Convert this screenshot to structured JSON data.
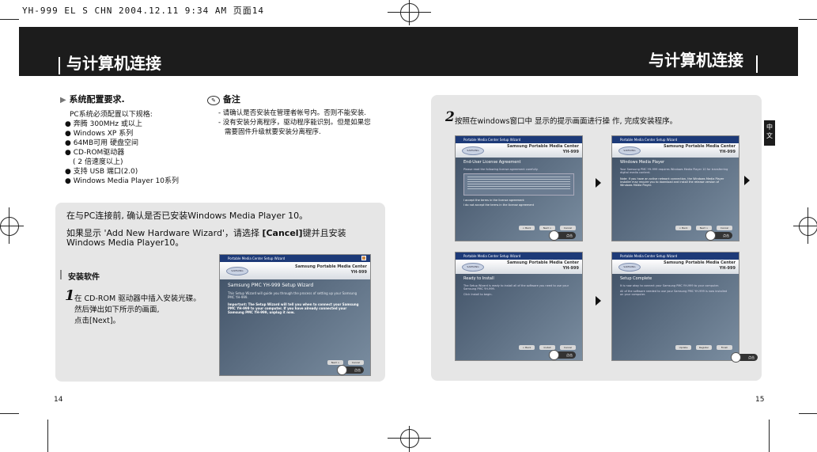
{
  "print_header": "YH-999 EL S CHN 2004.12.11 9:34 AM 页面14",
  "left_title": "与计算机连接",
  "right_title": "与计算机连接",
  "side_tab": "中文",
  "requirements": {
    "heading": "系统配置要求.",
    "intro": "PC系统必须配置以下规格:",
    "items": [
      "奔腾 300MHz 或以上",
      "Windows XP 系列",
      "64MB可用 硬盘空间",
      "CD-ROM驱动器",
      "( 2 倍速度以上)",
      "支持 USB 端口(2.0)",
      "Windows Media Player 10系列"
    ]
  },
  "note": {
    "heading": "备注",
    "lines": [
      "- 请确认是否安装在管理者帐号内。否则不能安装.",
      "- 没有安装分离程序，驱动程序能识别。但是如果您",
      "需要固件升级就要安装分离程序."
    ]
  },
  "left_panel": {
    "line1": "在与PC连接前, 确认是否已安装Windows Media Player 10。",
    "line2a": "如果显示 'Add New Hardware Wizard'，请选择 ",
    "line2b": "[Cancel]",
    "line2c": "键并且安装",
    "line3": "Windows Media Player10。",
    "section": "安装软件",
    "step_num": "1",
    "step_lines": [
      "在 CD-ROM 驱动器中插入安装光碟。",
      "然后弹出如下所示的画面,",
      "点击[Next]。"
    ]
  },
  "right_panel": {
    "step_num": "2",
    "step_text": "按照在windows窗口中 显示的提示画面进行操 作, 完成安装程序。"
  },
  "windows": {
    "titlebar": "Portable Media Center Setup Wizard",
    "logo": "SAMSUNG",
    "brand_line1": "Samsung Portable Media Center",
    "brand_line2": "YH-999",
    "click_badge": "点击",
    "main": {
      "title": "Samsung PMC YH-999 Setup Wizard",
      "p1": "This Setup Wizard will guide you through the process of setting up your Samsung PMC YH-999.",
      "p2": "Important: The Setup Wizard will tell you when to connect your Samsung PMC YH-999 to your computer. If you have already connected your Samsung PMC YH-999, unplug it now.",
      "buttons": [
        "Next >",
        "Cancel"
      ]
    },
    "w1": {
      "title": "End-User License Agreement",
      "sub": "Please read the following license agreement carefully.",
      "opt1": "I accept the terms in the license agreement",
      "opt2": "I do not accept the terms in the license agreement",
      "buttons": [
        "< Back",
        "Next >",
        "Cancel"
      ]
    },
    "w2": {
      "title": "Windows Media Player",
      "sub": "Your Samsung PMC YH-999 requires Windows Media Player 10 for transferring digital media content.",
      "note": "Note: If you have an active network connection, the Windows Media Player installer may require you to download and install the release version of Windows Media Player.",
      "buttons": [
        "< Back",
        "Next >",
        "Cancel"
      ]
    },
    "w3": {
      "title": "Ready to Install",
      "sub": "The Setup Wizard is ready to install all of the software you need to use your Samsung PMC YH-999.",
      "sub2": "Click Install to begin.",
      "buttons": [
        "< Back",
        "Install",
        "Cancel"
      ]
    },
    "w4": {
      "title": "Setup Complete",
      "sub": "It is now okay to connect your Samsung PMC YH-999 to your computer.",
      "sub2": "All of the software needed to use your Samsung PMC YH-999 is now installed on your computer.",
      "buttons": [
        "Update",
        "Register",
        "Finish"
      ]
    }
  },
  "page_left": "14",
  "page_right": "15"
}
